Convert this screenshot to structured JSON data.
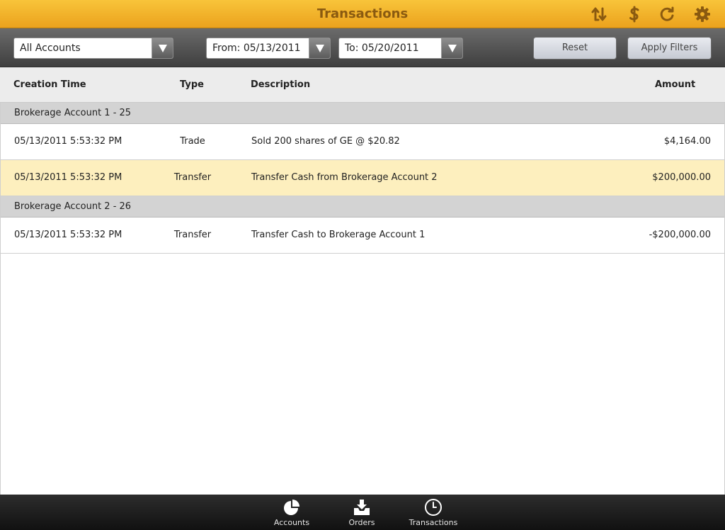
{
  "header": {
    "title": "Transactions",
    "icons": [
      "transfer-icon",
      "dollar-icon",
      "refresh-icon",
      "gear-icon"
    ]
  },
  "filters": {
    "account_select": "All Accounts",
    "from_date": "From: 05/13/2011",
    "to_date": "To: 05/20/2011",
    "reset_label": "Reset",
    "apply_label": "Apply Filters"
  },
  "columns": {
    "time": "Creation Time",
    "type": "Type",
    "description": "Description",
    "amount": "Amount"
  },
  "groups": [
    {
      "title": "Brokerage Account 1 - 25",
      "rows": [
        {
          "time": "05/13/2011 5:53:32 PM",
          "type": "Trade",
          "description": "Sold 200 shares of GE @ $20.82",
          "amount": "$4,164.00",
          "selected": false
        },
        {
          "time": "05/13/2011 5:53:32 PM",
          "type": "Transfer",
          "description": "Transfer Cash from Brokerage Account 2",
          "amount": "$200,000.00",
          "selected": true
        }
      ]
    },
    {
      "title": "Brokerage Account 2 - 26",
      "rows": [
        {
          "time": "05/13/2011 5:53:32 PM",
          "type": "Transfer",
          "description": "Transfer Cash to Brokerage Account 1",
          "amount": "-$200,000.00",
          "selected": false
        }
      ]
    }
  ],
  "tabs": [
    {
      "label": "Accounts",
      "icon": "pie-chart-icon"
    },
    {
      "label": "Orders",
      "icon": "inbox-download-icon"
    },
    {
      "label": "Transactions",
      "icon": "clock-icon"
    }
  ],
  "colors": {
    "header_top": "#f8c43a",
    "header_bottom": "#eba21d",
    "title_text": "#8a5a10",
    "selected_row": "#fdefbe",
    "group_row": "#d3d3d3"
  }
}
